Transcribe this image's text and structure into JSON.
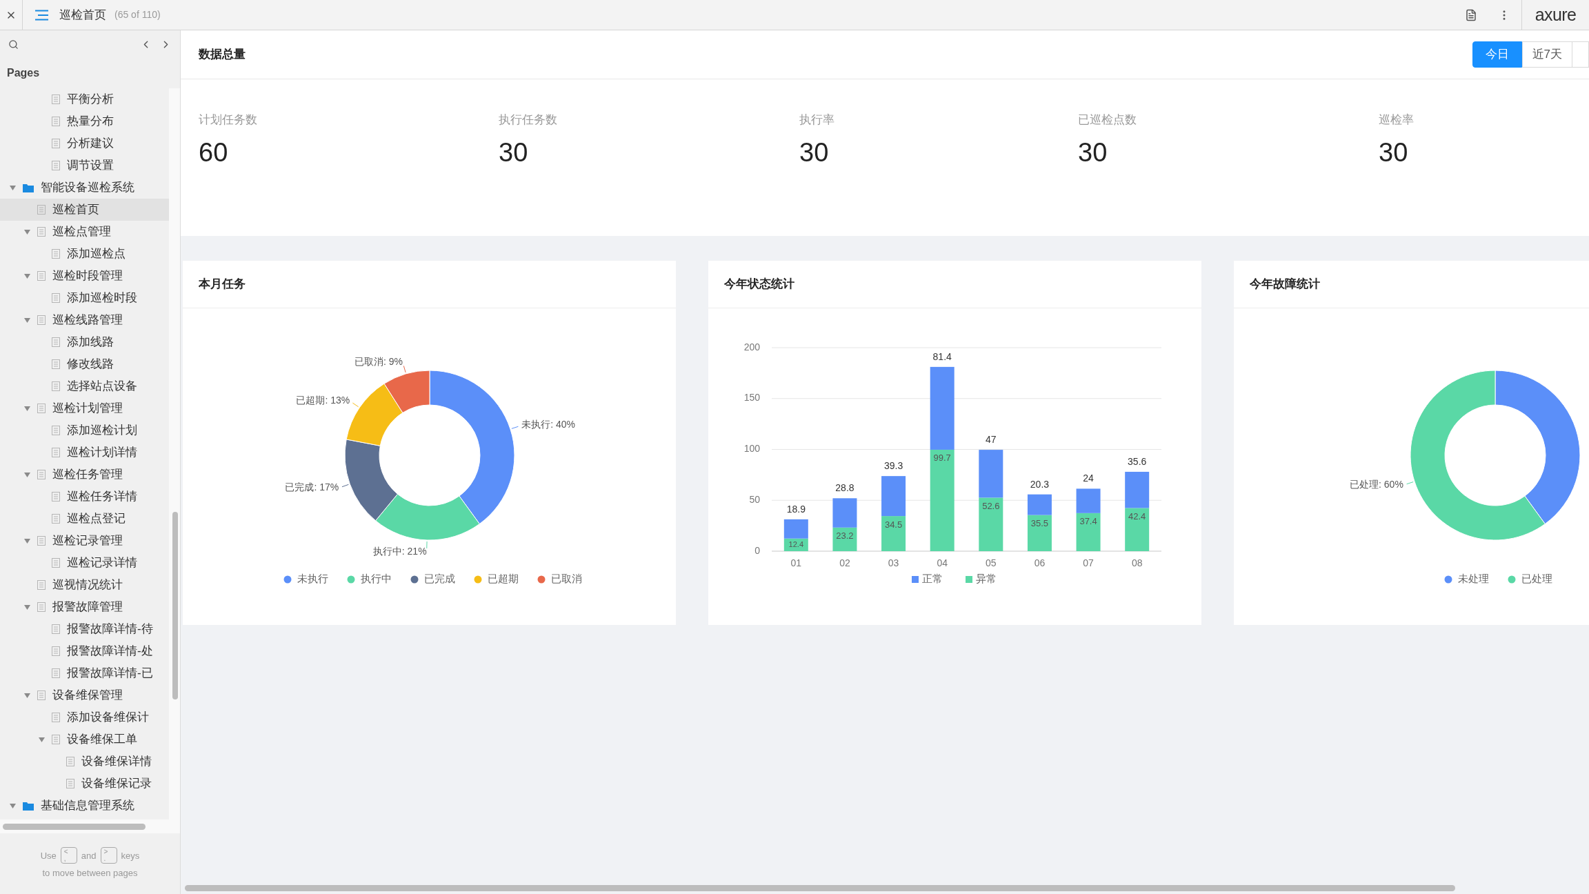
{
  "topbar": {
    "title": "巡检首页",
    "page_count": "(65 of 110)",
    "logo": "axure"
  },
  "sidebar": {
    "heading": "Pages",
    "tree": [
      {
        "children": [
          {
            "children": [
              {
                "label": "平衡分析",
                "kind": "page",
                "selected": false
              },
              {
                "label": "热量分布",
                "kind": "page",
                "selected": false
              },
              {
                "label": "分析建议",
                "kind": "page",
                "selected": false
              },
              {
                "label": "调节设置",
                "kind": "page",
                "selected": false
              }
            ]
          }
        ]
      },
      {
        "label": "智能设备巡检系统",
        "kind": "folder",
        "expanded": true,
        "selected": false,
        "children": [
          {
            "label": "巡检首页",
            "kind": "page",
            "selected": true
          },
          {
            "label": "巡检点管理",
            "kind": "page",
            "expanded": true,
            "selected": false,
            "children": [
              {
                "label": "添加巡检点",
                "kind": "page",
                "selected": false
              }
            ]
          },
          {
            "label": "巡检时段管理",
            "kind": "page",
            "expanded": true,
            "selected": false,
            "children": [
              {
                "label": "添加巡检时段",
                "kind": "page",
                "selected": false
              }
            ]
          },
          {
            "label": "巡检线路管理",
            "kind": "page",
            "expanded": true,
            "selected": false,
            "children": [
              {
                "label": "添加线路",
                "kind": "page",
                "selected": false
              },
              {
                "label": "修改线路",
                "kind": "page",
                "selected": false
              },
              {
                "label": "选择站点设备",
                "kind": "page",
                "selected": false
              }
            ]
          },
          {
            "label": "巡检计划管理",
            "kind": "page",
            "expanded": true,
            "selected": false,
            "children": [
              {
                "label": "添加巡检计划",
                "kind": "page",
                "selected": false
              },
              {
                "label": "巡检计划详情",
                "kind": "page",
                "selected": false
              }
            ]
          },
          {
            "label": "巡检任务管理",
            "kind": "page",
            "expanded": true,
            "selected": false,
            "children": [
              {
                "label": "巡检任务详情",
                "kind": "page",
                "selected": false
              },
              {
                "label": "巡检点登记",
                "kind": "page",
                "selected": false
              }
            ]
          },
          {
            "label": "巡检记录管理",
            "kind": "page",
            "expanded": true,
            "selected": false,
            "children": [
              {
                "label": "巡检记录详情",
                "kind": "page",
                "selected": false
              }
            ]
          },
          {
            "label": "巡视情况统计",
            "kind": "page",
            "selected": false
          },
          {
            "label": "报警故障管理",
            "kind": "page",
            "expanded": true,
            "selected": false,
            "children": [
              {
                "label": "报警故障详情-待",
                "kind": "page",
                "selected": false
              },
              {
                "label": "报警故障详情-处",
                "kind": "page",
                "selected": false
              },
              {
                "label": "报警故障详情-已",
                "kind": "page",
                "selected": false
              }
            ]
          },
          {
            "label": "设备维保管理",
            "kind": "page",
            "expanded": true,
            "selected": false,
            "children": [
              {
                "label": "添加设备维保计",
                "kind": "page",
                "selected": false
              },
              {
                "label": "设备维保工单",
                "kind": "page",
                "expanded": true,
                "selected": false,
                "children": [
                  {
                    "label": "设备维保详情",
                    "kind": "page",
                    "selected": false
                  },
                  {
                    "label": "设备维保记录",
                    "kind": "page",
                    "selected": false
                  }
                ]
              }
            ]
          }
        ]
      },
      {
        "label": "基础信息管理系统",
        "kind": "folder",
        "expanded": true,
        "selected": false
      }
    ],
    "footer": {
      "use": "Use",
      "prev_key": [
        "<",
        ","
      ],
      "and": "and",
      "next_key": [
        ">",
        "."
      ],
      "keys": "keys",
      "hint": "to move between pages"
    }
  },
  "main": {
    "title": "数据总量",
    "ranges": [
      {
        "label": "今日",
        "selected": true
      },
      {
        "label": "近7天",
        "selected": false
      }
    ],
    "stats": [
      {
        "label": "计划任务数",
        "value": "60"
      },
      {
        "label": "执行任务数",
        "value": "30"
      },
      {
        "label": "执行率",
        "value": "30"
      },
      {
        "label": "已巡检点数",
        "value": "30"
      },
      {
        "label": "巡检率",
        "value": "30"
      }
    ],
    "cards": [
      {
        "title": "本月任务",
        "chart_data": {
          "type": "donut",
          "categories": [
            "未执行",
            "执行中",
            "已完成",
            "已超期",
            "已取消"
          ],
          "colors": [
            "#5b8ff9",
            "#5ad8a6",
            "#5d7092",
            "#f6bd16",
            "#e8684a"
          ],
          "values": [
            40,
            21,
            17,
            13,
            9
          ],
          "value_labels": [
            "未执行: 40%",
            "执行中: 21%",
            "已完成: 17%",
            "已超期: 13%",
            "已取消: 9%"
          ],
          "legend": "bottom"
        }
      },
      {
        "title": "今年状态统计",
        "chart_data": {
          "type": "bar",
          "stacked": true,
          "categories": [
            "01",
            "02",
            "03",
            "04",
            "05",
            "06",
            "07",
            "08"
          ],
          "ylim": [
            0,
            200
          ],
          "yticks": [
            0,
            50,
            100,
            150,
            200
          ],
          "data_labels": true,
          "grid": true,
          "legend": "bottom",
          "series": [
            {
              "name": "正常",
              "color": "#5b8ff9",
              "values": [
                18.9,
                28.8,
                39.3,
                81.4,
                47,
                20.3,
                24,
                35.6
              ]
            },
            {
              "name": "异常",
              "color": "#5ad8a6",
              "values": [
                12.4,
                23.2,
                34.5,
                99.7,
                52.6,
                35.5,
                37.4,
                42.4
              ]
            }
          ]
        }
      },
      {
        "title": "今年故障统计",
        "chart_data": {
          "type": "donut",
          "categories": [
            "未处理",
            "已处理"
          ],
          "colors": [
            "#5b8ff9",
            "#5ad8a6"
          ],
          "values": [
            40,
            60
          ],
          "value_labels": [
            null,
            "已处理: 60%"
          ],
          "legend": "bottom"
        }
      }
    ]
  }
}
